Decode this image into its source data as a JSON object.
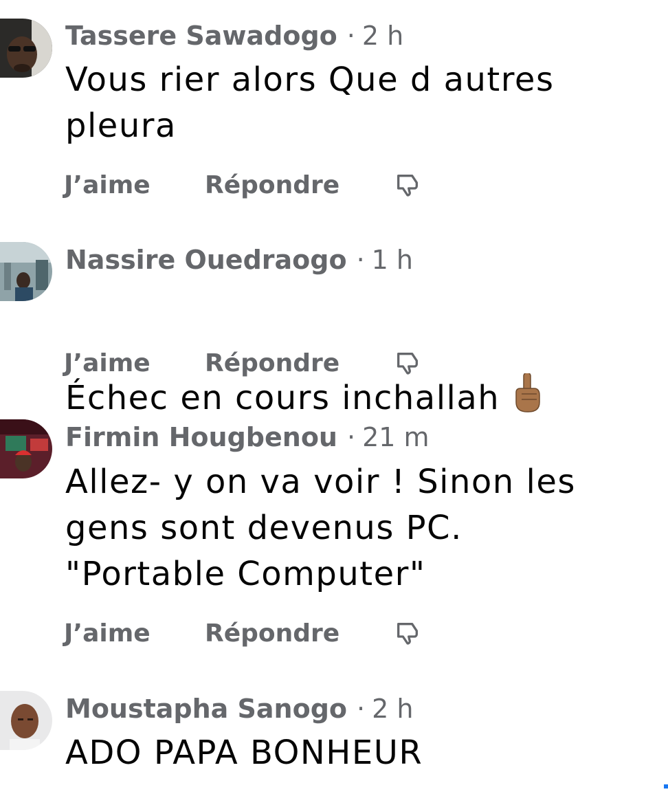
{
  "comments": [
    {
      "author": "Tassere Sawadogo",
      "time": "2 h",
      "text": "Vous rier alors Que d autres\npleura",
      "like_label": "J’aime",
      "reply_label": "Répondre",
      "dislike_icon": "thumbs-down-icon",
      "avatar_icon": "avatar-photo"
    },
    {
      "author": "Nassire Ouedraogo",
      "time": "1 h",
      "text": "Échec en cours inchallah",
      "emoji": "☝🏾",
      "like_label": "J’aime",
      "reply_label": "Répondre",
      "dislike_icon": "thumbs-down-icon",
      "avatar_icon": "avatar-photo"
    },
    {
      "author": "Firmin Hougbenou",
      "time": "21 m",
      "text": "Allez- y on va voir ! Sinon les\ngens sont devenus PC.\n\"Portable Computer\"",
      "like_label": "J’aime",
      "reply_label": "Répondre",
      "dislike_icon": "thumbs-down-icon",
      "avatar_icon": "avatar-photo"
    },
    {
      "author": "Moustapha Sanogo",
      "time": "2 h",
      "text": "ADO PAPA BONHEUR",
      "avatar_icon": "avatar-photo"
    }
  ],
  "separator": "·",
  "colors": {
    "meta_gray": "#65676b",
    "text_dark": "#050505",
    "background": "#ffffff"
  }
}
